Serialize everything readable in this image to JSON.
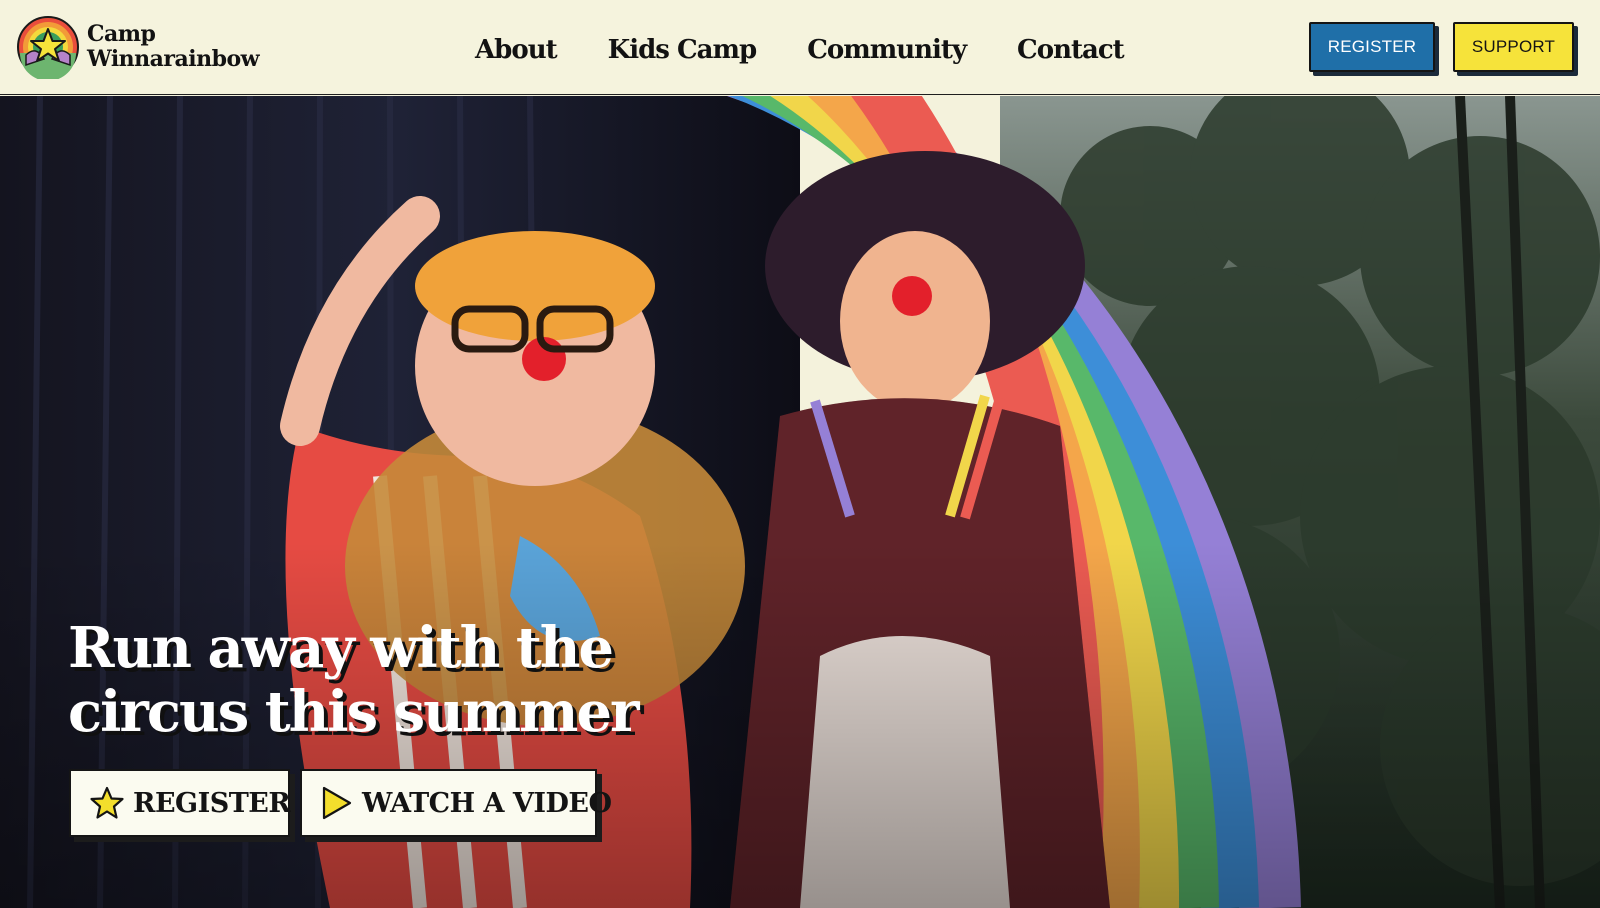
{
  "brand": {
    "name_line1": "Camp",
    "name_line2": "Winnarainbow",
    "logo_icon": "rainbow-star-logo"
  },
  "nav": {
    "items": [
      {
        "label": "About"
      },
      {
        "label": "Kids Camp"
      },
      {
        "label": "Community"
      },
      {
        "label": "Contact"
      }
    ]
  },
  "header_buttons": {
    "register_label": "REGISTER",
    "support_label": "SUPPORT"
  },
  "hero": {
    "headline": "Run away with the circus this summer",
    "register_label": "REGISTER",
    "register_icon": "star-icon",
    "video_label": "WATCH A VIDEO",
    "video_icon": "play-icon",
    "image_description_icon": "hero-photo"
  },
  "colors": {
    "header_bg": "#f5f3dd",
    "register_blue": "#1f6fa8",
    "support_yellow": "#f6e33a",
    "star_yellow": "#f3de2c",
    "text_dark": "#121212"
  }
}
